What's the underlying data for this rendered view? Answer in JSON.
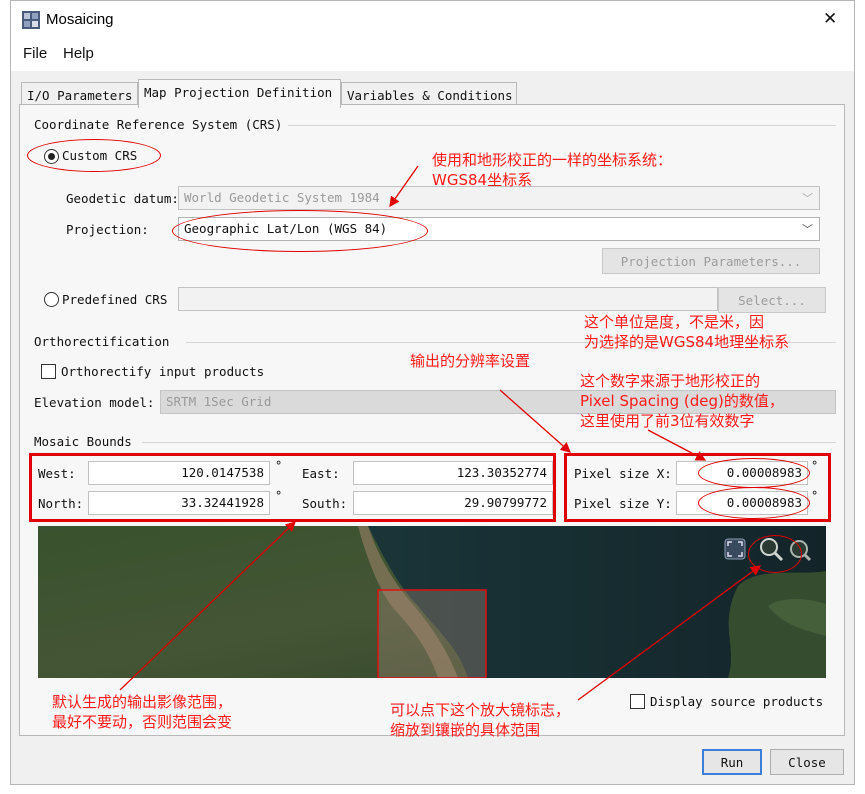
{
  "window": {
    "title": "Mosaicing",
    "close_glyph": "✕"
  },
  "menu": {
    "items": [
      "File",
      "Help"
    ]
  },
  "tabs": [
    {
      "label": "I/O Parameters",
      "active": false
    },
    {
      "label": "Map Projection Definition",
      "active": true
    },
    {
      "label": "Variables & Conditions",
      "active": false
    }
  ],
  "crs": {
    "group_title": "Coordinate Reference System (CRS)",
    "custom_label": "Custom CRS",
    "custom_selected": true,
    "geodetic_label": "Geodetic datum:",
    "geodetic_value": "World Geodetic System 1984",
    "projection_label": "Projection:",
    "projection_value": "Geographic Lat/Lon (WGS 84)",
    "projection_params_button": "Projection Parameters...",
    "predefined_label": "Predefined CRS",
    "predefined_selected": false,
    "predefined_value": "",
    "select_button": "Select..."
  },
  "ortho": {
    "group_title": "Orthorectification",
    "checkbox_label": "Orthorectify input products",
    "checked": false,
    "elevation_label": "Elevation model:",
    "elevation_value": "SRTM 1Sec Grid"
  },
  "bounds": {
    "group_title": "Mosaic Bounds",
    "west_label": "West:",
    "west_value": "120.0147538",
    "east_label": "East:",
    "east_value": "123.30352774",
    "north_label": "North:",
    "north_value": "33.32441928",
    "south_label": "South:",
    "south_value": "29.90799772",
    "deg_symbol": "°",
    "pixel_x_label": "Pixel size X:",
    "pixel_x_value": "0.00008983",
    "pixel_y_label": "Pixel size Y:",
    "pixel_y_value": "0.00008983"
  },
  "display_source_label": "Display source products",
  "display_source_checked": false,
  "footer": {
    "run_label": "Run",
    "close_label": "Close"
  },
  "annotations": {
    "crs_note_line1": "使用和地形校正的一样的坐标系统：",
    "crs_note_line2": "WGS84坐标系",
    "unit_note_line1": "这个单位是度，不是米，因",
    "unit_note_line2": "为选择的是WGS84地理坐标系",
    "resolution_note": "输出的分辨率设置",
    "source_note_line1": "这个数字来源于地形校正的",
    "source_note_line2": "Pixel Spacing (deg)的数值，",
    "source_note_line3": "这里使用了前3位有效数字",
    "bounds_note_line1": "默认生成的输出影像范围，",
    "bounds_note_line2": "最好不要动，否则范围会变",
    "zoom_note_line1": "可以点下这个放大镜标志，",
    "zoom_note_line2": "缩放到镶嵌的具体范围"
  },
  "colors": {
    "annotation_red": "#e00000",
    "default_button_border": "#3c7fd6"
  }
}
